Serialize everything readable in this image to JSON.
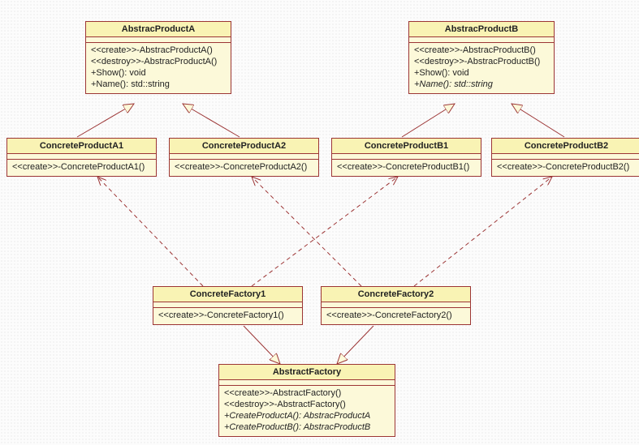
{
  "boxes": {
    "apA": {
      "title": "AbstracProductA",
      "ops": [
        {
          "text": "<<create>>-AbstracProductA()",
          "italic": false
        },
        {
          "text": "<<destroy>>-AbstracProductA()",
          "italic": false
        },
        {
          "text": "+Show(): void",
          "italic": false
        },
        {
          "text": "+Name(): std::string",
          "italic": false
        }
      ]
    },
    "apB": {
      "title": "AbstracProductB",
      "ops": [
        {
          "text": "<<create>>-AbstracProductB()",
          "italic": false
        },
        {
          "text": "<<destroy>>-AbstracProductB()",
          "italic": false
        },
        {
          "text": "+Show(): void",
          "italic": false
        },
        {
          "text": "+Name(): std::string",
          "italic": true
        }
      ]
    },
    "cpA1": {
      "title": "ConcreteProductA1",
      "ops": [
        {
          "text": "<<create>>-ConcreteProductA1()",
          "italic": false
        }
      ]
    },
    "cpA2": {
      "title": "ConcreteProductA2",
      "ops": [
        {
          "text": "<<create>>-ConcreteProductA2()",
          "italic": false
        }
      ]
    },
    "cpB1": {
      "title": "ConcreteProductB1",
      "ops": [
        {
          "text": "<<create>>-ConcreteProductB1()",
          "italic": false
        }
      ]
    },
    "cpB2": {
      "title": "ConcreteProductB2",
      "ops": [
        {
          "text": "<<create>>-ConcreteProductB2()",
          "italic": false
        }
      ]
    },
    "cf1": {
      "title": "ConcreteFactory1",
      "ops": [
        {
          "text": "<<create>>-ConcreteFactory1()",
          "italic": false
        }
      ]
    },
    "cf2": {
      "title": "ConcreteFactory2",
      "ops": [
        {
          "text": "<<create>>-ConcreteFactory2()",
          "italic": false
        }
      ]
    },
    "af": {
      "title": "AbstractFactory",
      "ops": [
        {
          "text": "<<create>>-AbstractFactory()",
          "italic": false
        },
        {
          "text": "<<destroy>>-AbstractFactory()",
          "italic": false
        },
        {
          "text": "+CreateProductA(): AbstracProductA",
          "italic": true
        },
        {
          "text": "+CreateProductB(): AbstracProductB",
          "italic": true
        }
      ]
    }
  }
}
